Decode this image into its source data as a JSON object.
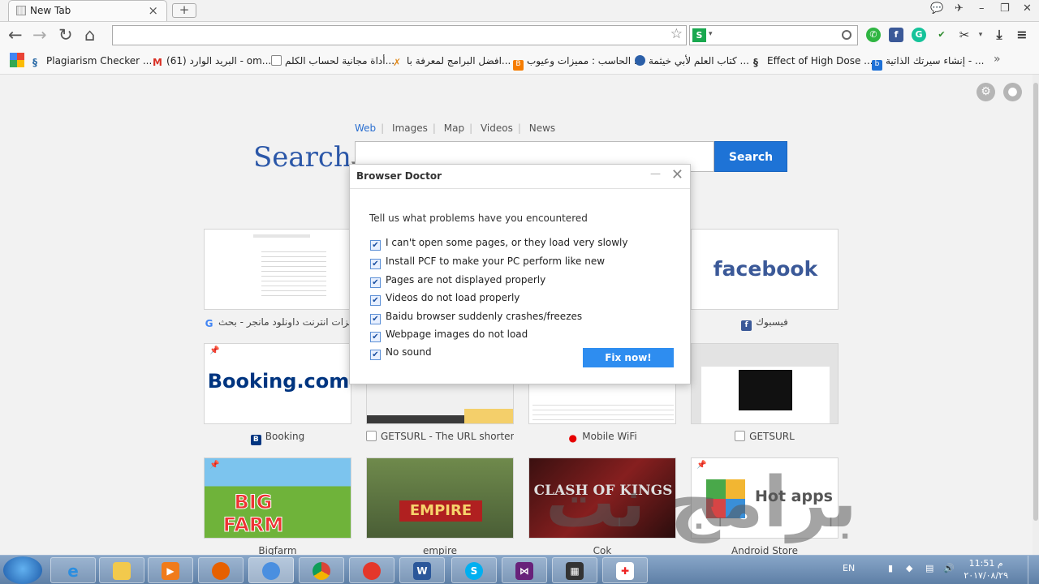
{
  "tab": {
    "title": "New Tab",
    "close": "×",
    "new_tab": "+"
  },
  "window_controls": {
    "minimize": "–",
    "maximize": "❐",
    "close": "✕"
  },
  "nav": {
    "back": "←",
    "forward": "→",
    "reload": "↻",
    "home": "⌂"
  },
  "address": {
    "value": "",
    "placeholder": ""
  },
  "search_engine_box": {
    "engine_letter": "S",
    "value": ""
  },
  "bookmarks": [
    {
      "label": "Plagiarism Checker ..."
    },
    {
      "label": "البريد الوارد (61) - om..."
    },
    {
      "label": "أداة مجانية لحساب الكلم..."
    },
    {
      "label": "افضل البرامج لمعرفة با..."
    },
    {
      "label": "الحاسب : مميزات وعيوب ..."
    },
    {
      "label": "كتاب العلم لأبي خيثمة ..."
    },
    {
      "label": "Effect of High Dose ..."
    },
    {
      "label": "إنشاء سيرتك الذاتية - ..."
    }
  ],
  "bookmarks_more": "»",
  "search_page": {
    "links": [
      "Web",
      "Images",
      "Map",
      "Videos",
      "News"
    ],
    "logo_text": "Search",
    "logo_caret": "▾",
    "input_value": "",
    "button_label": "Search"
  },
  "tiles": [
    {
      "label": "مميزات انترنت داونلود مانجر - بحث"
    },
    {
      "label": ""
    },
    {
      "label": ""
    },
    {
      "label": "فيسبوك",
      "thumb_text": "facebook"
    },
    {
      "label": "Booking",
      "thumb_text": "Booking.com"
    },
    {
      "label": "GETSURL - The URL shortene"
    },
    {
      "label": "Mobile WiFi"
    },
    {
      "label": "GETSURL"
    },
    {
      "label": "Bigfarm",
      "thumb_text": "BIG FARM"
    },
    {
      "label": "empire",
      "thumb_text": "EMPIRE"
    },
    {
      "label": "Cok",
      "thumb_text": "CLASH OF KINGS"
    },
    {
      "label": "Android Store",
      "thumb_text": "Hot apps"
    }
  ],
  "dialog": {
    "title": "Browser Doctor",
    "minimize": "—",
    "close": "✕",
    "question": "Tell us what problems have you encountered",
    "options": [
      {
        "label": "I can't open some pages, or they load very slowly",
        "checked": true
      },
      {
        "label": "Install PCF to make your PC perform like new",
        "checked": true
      },
      {
        "label": "Pages are not displayed properly",
        "checked": true
      },
      {
        "label": "Videos do not load properly",
        "checked": true
      },
      {
        "label": "Baidu browser suddenly crashes/freezes",
        "checked": true
      },
      {
        "label": "Webpage images do not load",
        "checked": true
      },
      {
        "label": "No sound",
        "checked": true
      }
    ],
    "fix_button": "Fix now!"
  },
  "taskbar": {
    "language": "EN",
    "time": "11:51 م",
    "date": "٢٠١٧/٠٨/٢٩"
  },
  "watermark": "برامج نت",
  "colors": {
    "accent": "#1e73d6",
    "facebook": "#3b5998",
    "booking": "#003580",
    "fix": "#2e8df0"
  }
}
